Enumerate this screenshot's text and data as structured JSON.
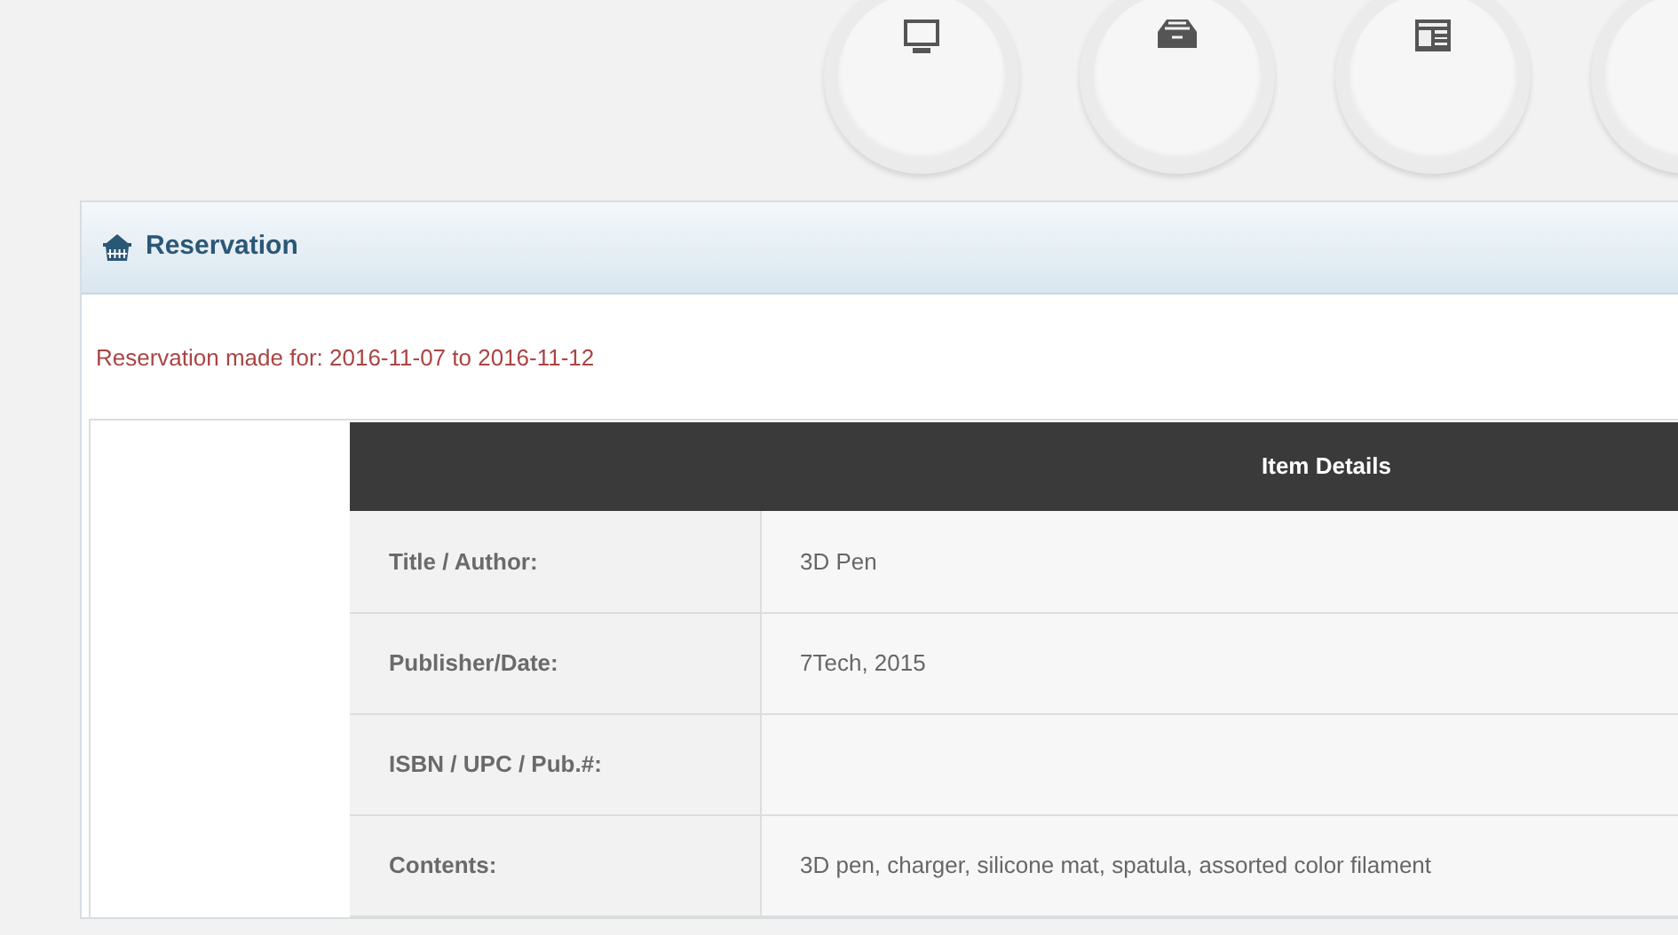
{
  "nav_buttons": [
    {
      "kind": "monitor"
    },
    {
      "kind": "drawer"
    },
    {
      "kind": "newspaper"
    },
    {
      "kind": "blank"
    }
  ],
  "panel": {
    "title": "Reservation",
    "message": "Reservation made for: 2016-11-07 to 2016-11-12"
  },
  "table": {
    "header": "Item Details",
    "rows": [
      {
        "label": "Title / Author:",
        "value": "3D Pen"
      },
      {
        "label": "Publisher/Date:",
        "value": "7Tech, 2015"
      },
      {
        "label": "ISBN / UPC / Pub.#:",
        "value": ""
      },
      {
        "label": "Contents:",
        "value": "3D pen, charger, silicone mat, spatula, assorted color filament"
      }
    ]
  }
}
